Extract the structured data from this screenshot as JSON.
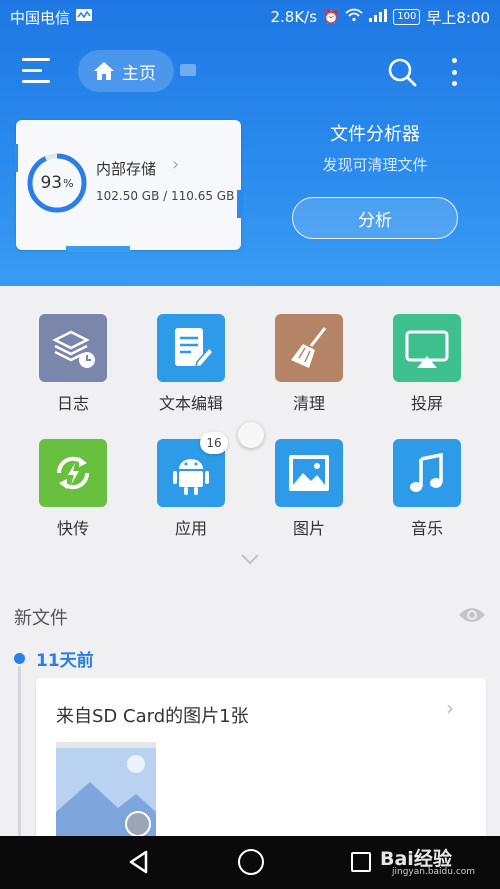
{
  "status_bar": {
    "carrier": "中国电信",
    "speed": "2.8K/s",
    "battery": "100",
    "time": "早上8:00"
  },
  "app_bar": {
    "home_label": "主页"
  },
  "storage": {
    "percent": "93",
    "percent_sign": "%",
    "percent_value": 93,
    "title": "内部存储",
    "size": "102.50 GB / 110.65 GB"
  },
  "analyzer": {
    "title": "文件分析器",
    "subtitle": "发现可清理文件",
    "button": "分析"
  },
  "tools": [
    {
      "label": "日志",
      "icon": "log-icon",
      "color": "#7b86ad"
    },
    {
      "label": "文本编辑",
      "icon": "text-edit-icon",
      "color": "#2d9be8"
    },
    {
      "label": "清理",
      "icon": "broom-icon",
      "color": "#b58466"
    },
    {
      "label": "投屏",
      "icon": "cast-icon",
      "color": "#3dc08e"
    },
    {
      "label": "快传",
      "icon": "transfer-icon",
      "color": "#69bf3e"
    },
    {
      "label": "应用",
      "icon": "android-icon",
      "color": "#2d9be8"
    },
    {
      "label": "图片",
      "icon": "picture-icon",
      "color": "#2d9be8"
    },
    {
      "label": "音乐",
      "icon": "music-icon",
      "color": "#2d9be8"
    }
  ],
  "apps_badge": "16",
  "new_files": {
    "title": "新文件",
    "group_label": "11天前",
    "card_title": "来自SD Card的图片1张"
  },
  "watermark": {
    "brand": "Bai经验",
    "url": "jingyan.baidu.com"
  }
}
